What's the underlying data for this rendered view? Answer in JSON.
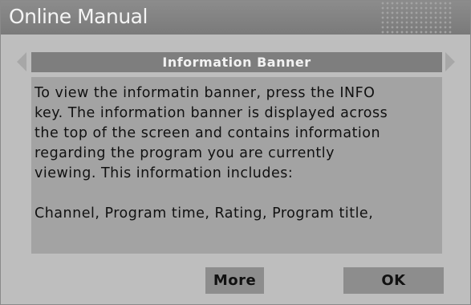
{
  "window": {
    "title": "Online Manual"
  },
  "nav": {
    "left_icon": "triangle-left",
    "right_icon": "triangle-right"
  },
  "banner": {
    "heading": "Information Banner"
  },
  "body": {
    "paragraph1": "To view the informatin banner, press the INFO\nkey. The information banner is displayed across\nthe top of the screen and contains information\nregarding the program you are currently\nviewing. This information includes:",
    "paragraph2": "Channel, Program time, Rating, Program title,"
  },
  "buttons": {
    "more_label": "More",
    "ok_label": "OK"
  },
  "colors": {
    "background": "#bebebe",
    "titlebar": "#828282",
    "content": "#a3a3a3",
    "header": "#7e7e7e",
    "button": "#8d8d8d"
  }
}
